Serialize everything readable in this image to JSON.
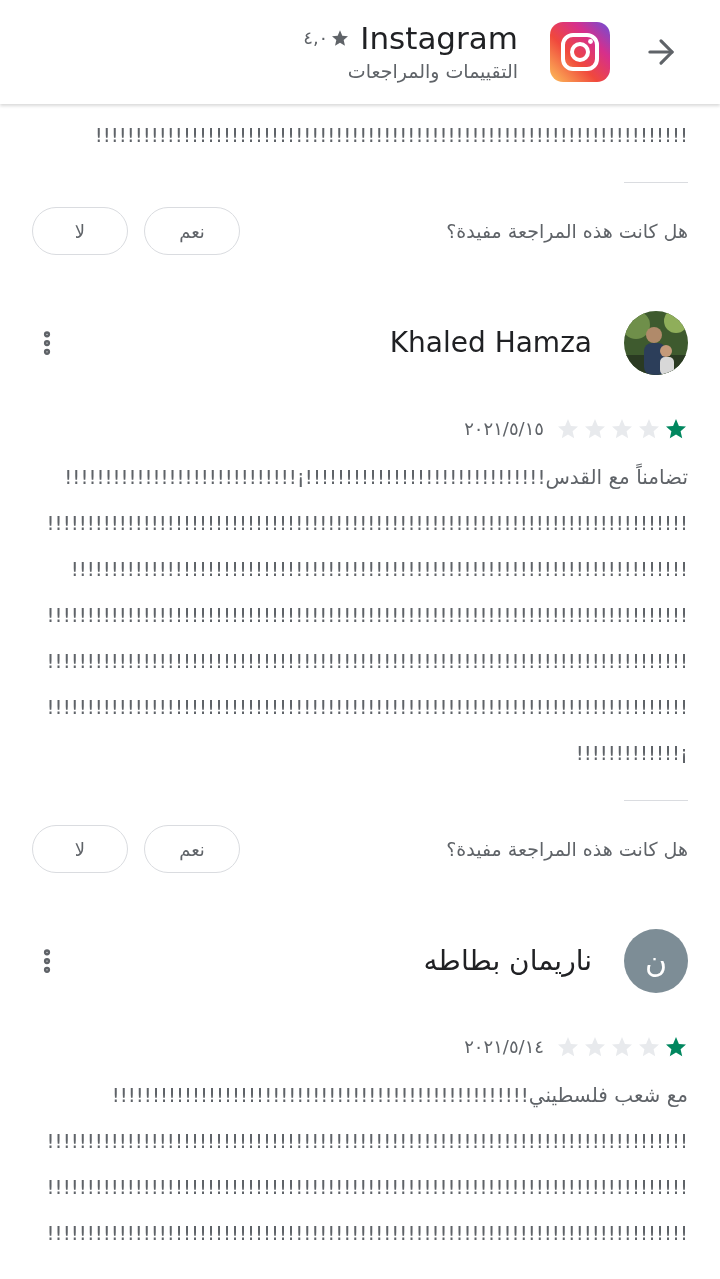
{
  "header": {
    "app_name": "Instagram",
    "rating": "٤,٠",
    "subtitle": "التقييمات والمراجعات"
  },
  "partial_review": {
    "body_lines": [
      "!!!!!!!!!!!!!!!!!!!!!!!!!!!!!!!!!!!!!!!!!!!!!!!!!!!!!!!!!!!!!!!!!!!!!!!!!!"
    ],
    "helpful": {
      "question": "هل كانت هذه المراجعة مفيدة؟",
      "yes": "نعم",
      "no": "لا"
    }
  },
  "reviews": [
    {
      "author": "Khaled Hamza",
      "stars": 1,
      "date": "٢٠٢١/٥/١٥",
      "body_lines": [
        "تضامناً مع القدس!!!!!!!!!!!!!!!!!!!!!!!!!!!!!!¡!!!!!!!!!!!!!!!!!!!!!!!!!!!!!",
        "!!!!!!!!!!!!!!!!!!!!!!!!!!!!!!!!!!!!!!!!!!!!!!!!!!!!!!!!!!!!!!!!!!!!!!!!!!!!!!!!",
        "!!!!!!!!!!!!!!!!!!!!!!!!!!!!!!!!!!!!!!!!!!!!!!!!!!!!!!!!!!!!!!!!!!!!!!!!!!!!!",
        "!!!!!!!!!!!!!!!!!!!!!!!!!!!!!!!!!!!!!!!!!!!!!!!!!!!!!!!!!!!!!!!!!!!!!!!!!!!!!!!!",
        "!!!!!!!!!!!!!!!!!!!!!!!!!!!!!!!!!!!!!!!!!!!!!!!!!!!!!!!!!!!!!!!!!!!!!!!!!!!!!!!!",
        "!!!!!!!!!!!!!!!!!!!!!!!!!!!!!!!!!!!!!!!!!!!!!!!!!!!!!!!!!!!!!!!!!!!!!!!!!!!!!!!!",
        "¡!!!!!!!!!!!!!"
      ],
      "helpful": {
        "question": "هل كانت هذه المراجعة مفيدة؟",
        "yes": "نعم",
        "no": "لا"
      }
    },
    {
      "author": "ناريمان بطاطه",
      "avatar": {
        "kind": "letter",
        "letter": "ن"
      },
      "stars": 1,
      "date": "٢٠٢١/٥/١٤",
      "body_lines": [
        "مع شعب فلسطيني!!!!!!!!!!!!!!!!!!!!!!!!!!!!!!!!!!!!!!!!!!!!!!!!!!!!",
        "!!!!!!!!!!!!!!!!!!!!!!!!!!!!!!!!!!!!!!!!!!!!!!!!!!!!!!!!!!!!!!!!!!!!!!!!!!!!!!!!",
        "!!!!!!!!!!!!!!!!!!!!!!!!!!!!!!!!!!!!!!!!!!!!!!!!!!!!!!!!!!!!!!!!!!!!!!!!!!!!!!!!",
        "!!!!!!!!!!!!!!!!!!!!!!!!!!!!!!!!!!!!!!!!!!!!!!!!!!!!!!!!!!!!!!!!!!!!!!!!!!!!!!!!"
      ]
    }
  ]
}
